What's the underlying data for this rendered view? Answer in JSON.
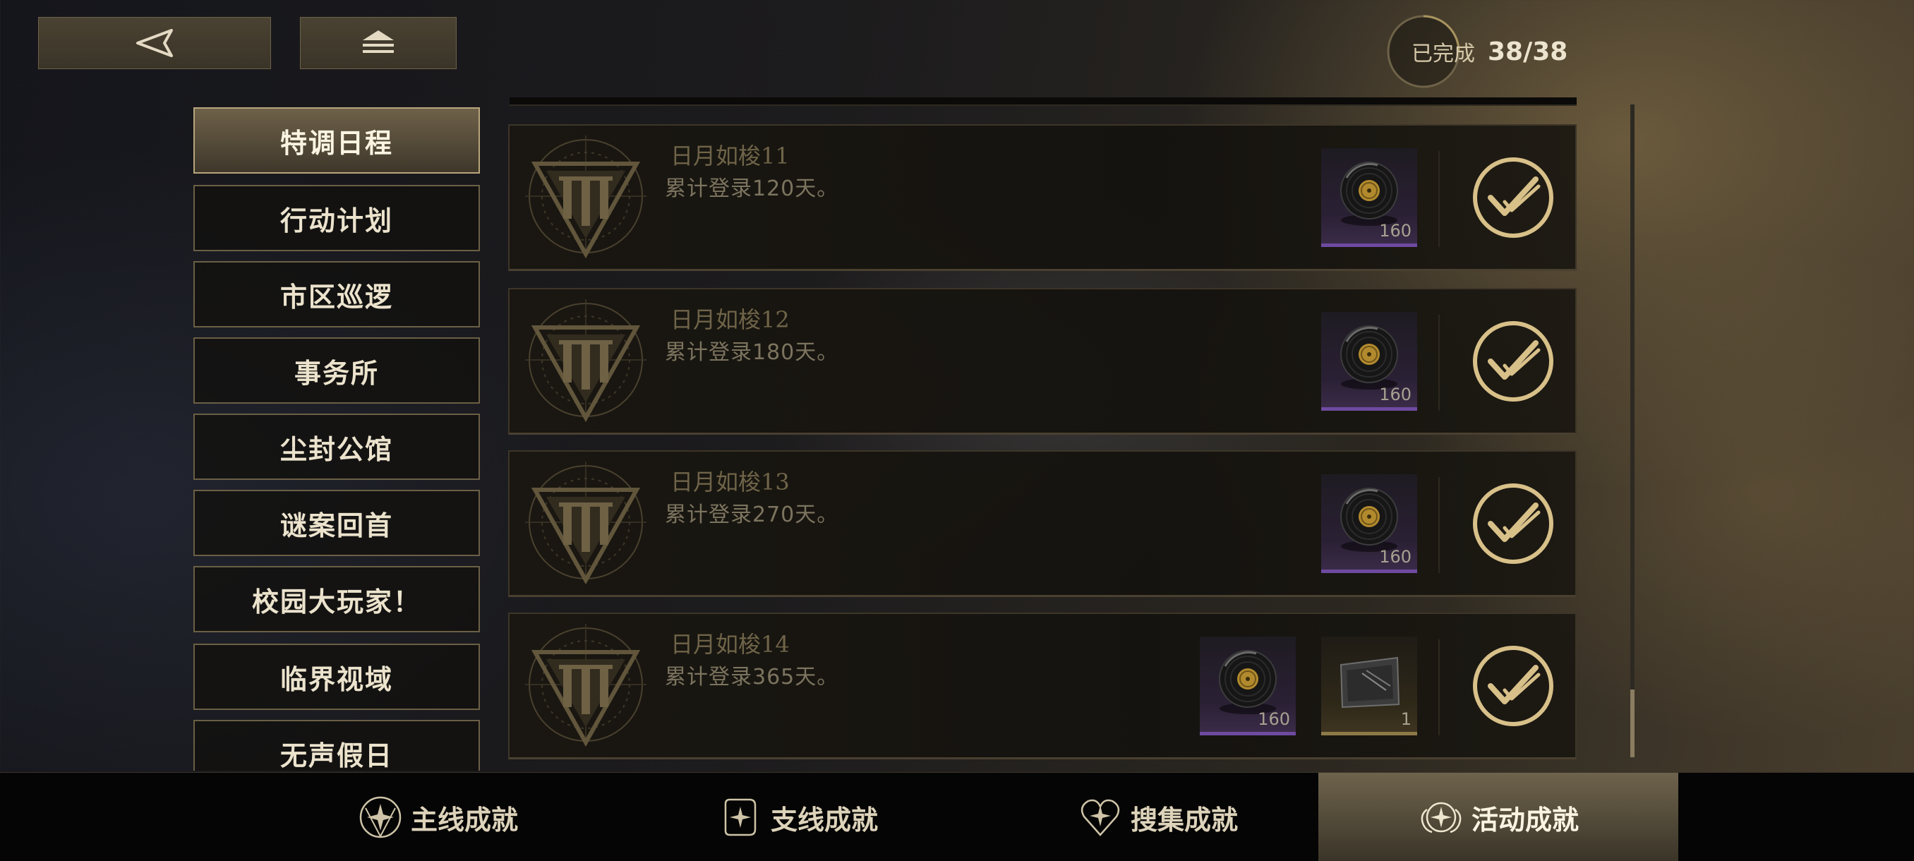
{
  "header": {
    "back_icon": "back-arrow-icon",
    "home_icon": "home-stack-icon",
    "completion_label": "已完成",
    "completion_value": "38/38"
  },
  "sidebar": {
    "items": [
      {
        "label": "特调日程",
        "active": true
      },
      {
        "label": "行动计划",
        "active": false
      },
      {
        "label": "市区巡逻",
        "active": false
      },
      {
        "label": "事务所",
        "active": false
      },
      {
        "label": "尘封公馆",
        "active": false
      },
      {
        "label": "谜案回首",
        "active": false
      },
      {
        "label": "校园大玩家！",
        "active": false
      },
      {
        "label": "临界视域",
        "active": false
      },
      {
        "label": "无声假日",
        "active": false
      }
    ]
  },
  "achievements": [
    {
      "title": "日月如梭11",
      "desc": "累计登录120天。",
      "rewards": [
        {
          "icon": "record-disc-icon",
          "count": "160"
        }
      ],
      "completed": true
    },
    {
      "title": "日月如梭12",
      "desc": "累计登录180天。",
      "rewards": [
        {
          "icon": "record-disc-icon",
          "count": "160"
        }
      ],
      "completed": true
    },
    {
      "title": "日月如梭13",
      "desc": "累计登录270天。",
      "rewards": [
        {
          "icon": "record-disc-icon",
          "count": "160"
        }
      ],
      "completed": true
    },
    {
      "title": "日月如梭14",
      "desc": "累计登录365天。",
      "rewards": [
        {
          "icon": "record-disc-icon",
          "count": "160"
        },
        {
          "icon": "card-ticket-icon",
          "count": "1"
        }
      ],
      "completed": true
    }
  ],
  "bottom_nav": [
    {
      "label": "主线成就",
      "icon": "star-shield-icon",
      "active": false
    },
    {
      "label": "支线成就",
      "icon": "star-scroll-icon",
      "active": false
    },
    {
      "label": "搜集成就",
      "icon": "star-heart-icon",
      "active": false
    },
    {
      "label": "活动成就",
      "icon": "star-wings-icon",
      "active": true
    }
  ],
  "colors": {
    "accent_gold": "#d8c089",
    "reward_purple": "#6e4aa0",
    "reward_gold": "#8e7a48"
  }
}
